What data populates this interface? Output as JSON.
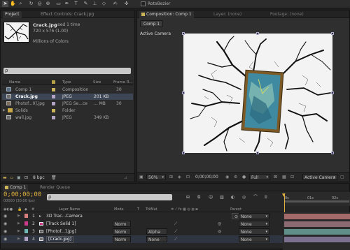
{
  "toolbar": {
    "rotobezier_label": "RotoBezier",
    "tools": [
      "selection-tool",
      "hand-tool",
      "zoom-tool",
      "rotation-tool",
      "camera-tool",
      "pan-behind-tool",
      "mask-tool",
      "pen-tool",
      "type-tool",
      "brush-tool",
      "clone-stamp-tool",
      "eraser-tool",
      "roto-brush-tool",
      "puppet-pin-tool"
    ]
  },
  "project": {
    "tab_label": "Project",
    "effect_controls_label": "Effect Controls: Crack.jpg",
    "item_name": "Crack.jpg",
    "item_used": ", used 1 time",
    "item_dims": "720 x 576 (1.00)",
    "item_colors": "Millions of Colors",
    "search_placeholder": "ρ",
    "columns": {
      "name": "Name",
      "type": "Type",
      "size": "Size",
      "frame_rate": "Frame R..."
    },
    "items": [
      {
        "name": "Comp 1",
        "type": "Composition",
        "size": "",
        "rate": "30",
        "color": "#c9b45a",
        "icon": "composition-icon",
        "selected": false
      },
      {
        "name": "Crack.jpg",
        "type": "JPEG",
        "size": "201 KB",
        "rate": "",
        "color": "#b1a3c4",
        "icon": "image-file-icon",
        "selected": true
      },
      {
        "name": "Photof...0].jpg",
        "type": "JPEG Se...ce",
        "size": "... MB",
        "rate": "30",
        "color": "#b1a3c4",
        "icon": "image-sequence-icon",
        "selected": false
      },
      {
        "name": "Solids",
        "type": "Folder",
        "size": "",
        "rate": "",
        "color": "#c9b45a",
        "icon": "folder-icon",
        "selected": false
      },
      {
        "name": "wall.jpg",
        "type": "JPEG",
        "size": "349 KB",
        "rate": "",
        "color": "#b1a3c4",
        "icon": "image-file-icon",
        "selected": false
      }
    ],
    "bpc_label": "8 bpc"
  },
  "composition": {
    "tab_label": "Composition: Comp 1",
    "layer_tab_label": "Layer: (none)",
    "footage_tab_label": "Footage: (none)",
    "comp_button_label": "Comp 1",
    "viewer_label": "Active Camera",
    "zoom_value": "50%",
    "timecode": "0;00;00;00",
    "resolution_value": "Full",
    "view_value": "Active Camera"
  },
  "timeline": {
    "comp_tab_label": "Comp 1",
    "render_queue_label": "Render Queue",
    "timecode": "0;00;00;00",
    "fps_label": "00000 (30.00 fps)",
    "search_placeholder": "ρ",
    "columns": {
      "layer_name": "Layer Name",
      "mode": "Mode",
      "t": "T",
      "trkmat": "TrkMat",
      "parent": "Parent"
    },
    "ruler_labels": [
      "0s",
      "01s",
      "02s"
    ],
    "layers": [
      {
        "index": "1",
        "name": "3D Trac...Camera",
        "mode": "",
        "trkmat": "",
        "parent": "None",
        "color": "#d87f7f",
        "bar_color": "#a46a6a"
      },
      {
        "index": "2",
        "name": "[Track Solid 1]",
        "mode": "Norm",
        "trkmat": "",
        "parent": "None",
        "color": "#cc3a8a",
        "bar_color": "#8c6a72"
      },
      {
        "index": "3",
        "name": "[Photof...].jpg]",
        "mode": "Norm",
        "trkmat": "Alpha",
        "parent": "None",
        "color": "#6fb7b3",
        "bar_color": "#5f8f88"
      },
      {
        "index": "4",
        "name": "[Crack.jpg]",
        "mode": "Norm",
        "trkmat": "None",
        "parent": "None",
        "color": "#b1a3c4",
        "bar_color": "#7c7290"
      }
    ]
  }
}
